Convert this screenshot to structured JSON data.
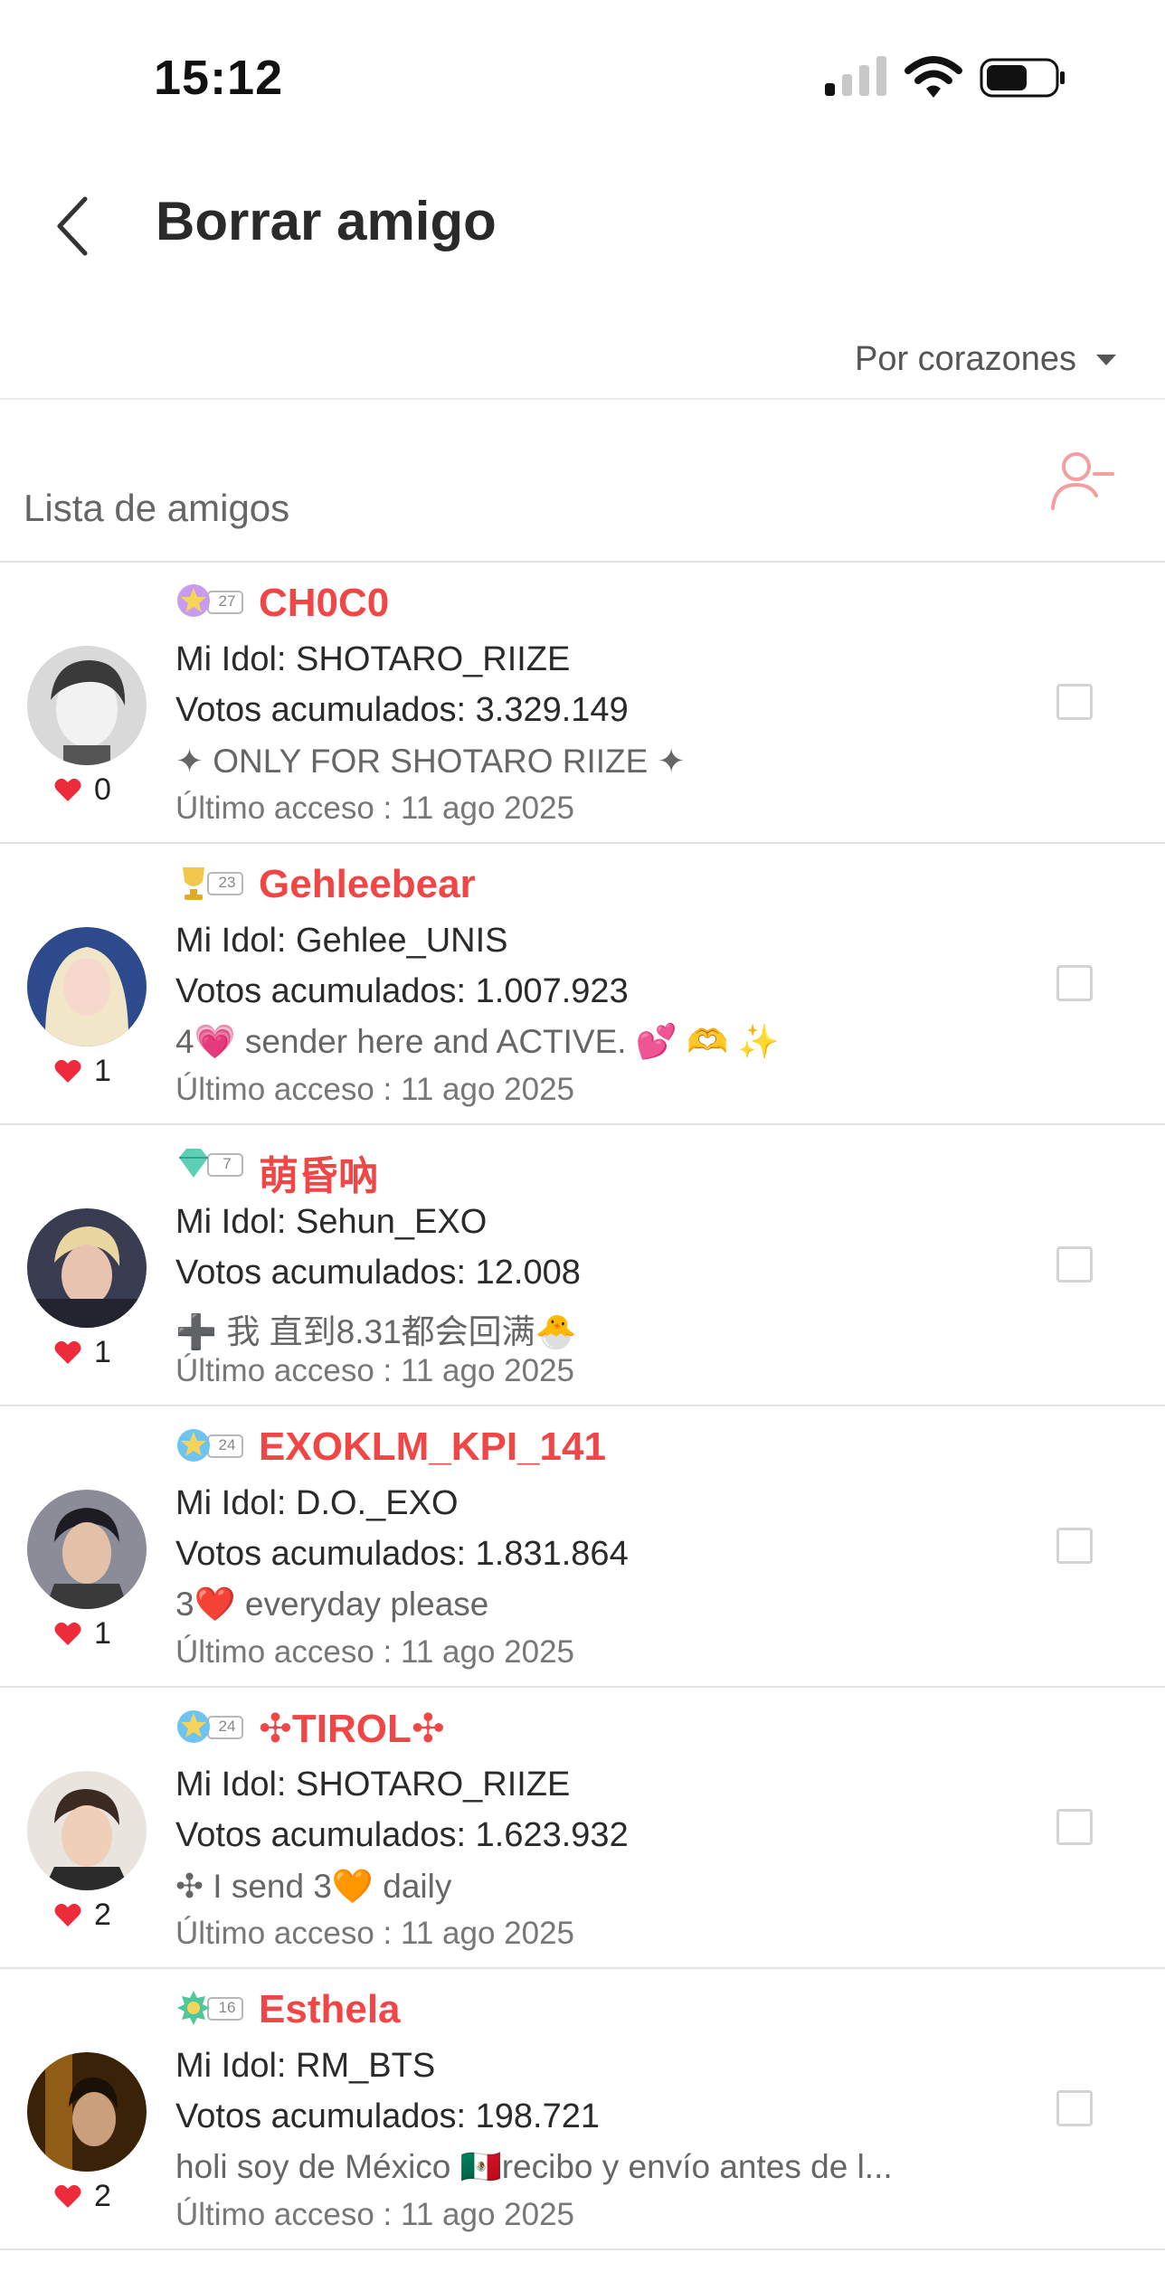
{
  "status_bar": {
    "time": "15:12"
  },
  "header": {
    "title": "Borrar amigo"
  },
  "sort": {
    "label": "Por corazones"
  },
  "list": {
    "title": "Lista de amigos"
  },
  "friends": [
    {
      "name": "CH0C0",
      "badge_level": "27",
      "badge_color": "#c69bf0",
      "idol": "Mi Idol: SHOTARO_RIIZE",
      "votes": "Votos acumulados: 3.329.149",
      "bio": "✦ ONLY FOR SHOTARO RIIZE ✦",
      "last_access": "Último acceso : 11 ago 2025",
      "hearts": "0"
    },
    {
      "name": "Gehleebear",
      "badge_level": "23",
      "badge_color": "#f2c84b",
      "idol": "Mi Idol: Gehlee_UNIS",
      "votes": "Votos acumulados: 1.007.923",
      "bio": "4💗 sender here and ACTIVE. 💕 🫶 ✨",
      "last_access": "Último acceso : 11 ago 2025",
      "hearts": "1"
    },
    {
      "name": "萌昏吶",
      "badge_level": "7",
      "badge_color": "#5ccfb4",
      "idol": "Mi Idol: Sehun_EXO",
      "votes": "Votos acumulados: 12.008",
      "bio": "➕ 我 直到8.31都会回满🐣",
      "last_access": "Último acceso : 11 ago 2025",
      "hearts": "1"
    },
    {
      "name": "EXOKLM_KPI_141",
      "badge_level": "24",
      "badge_color": "#6ec3f0",
      "idol": "Mi Idol: D.O._EXO",
      "votes": "Votos acumulados: 1.831.864",
      "bio": "3❤️ everyday please",
      "last_access": "Último acceso : 11 ago 2025",
      "hearts": "1"
    },
    {
      "name": "✣TIROL✣",
      "badge_level": "24",
      "badge_color": "#6ec3f0",
      "idol": "Mi Idol: SHOTARO_RIIZE",
      "votes": "Votos acumulados: 1.623.932",
      "bio": "✣  I send 3🧡 daily",
      "last_access": "Último acceso : 11 ago 2025",
      "hearts": "2"
    },
    {
      "name": "Esthela",
      "badge_level": "16",
      "badge_color": "#4fc79a",
      "idol": "Mi Idol: RM_BTS",
      "votes": "Votos acumulados: 198.721",
      "bio": "holi soy de México 🇲🇽recibo y envío antes de l...",
      "last_access": "Último acceso : 11 ago 2025",
      "hearts": "2"
    }
  ],
  "colors": {
    "accent": "#f04646",
    "heart": "#ee2b3b",
    "remove_icon": "#f0a0a0"
  }
}
